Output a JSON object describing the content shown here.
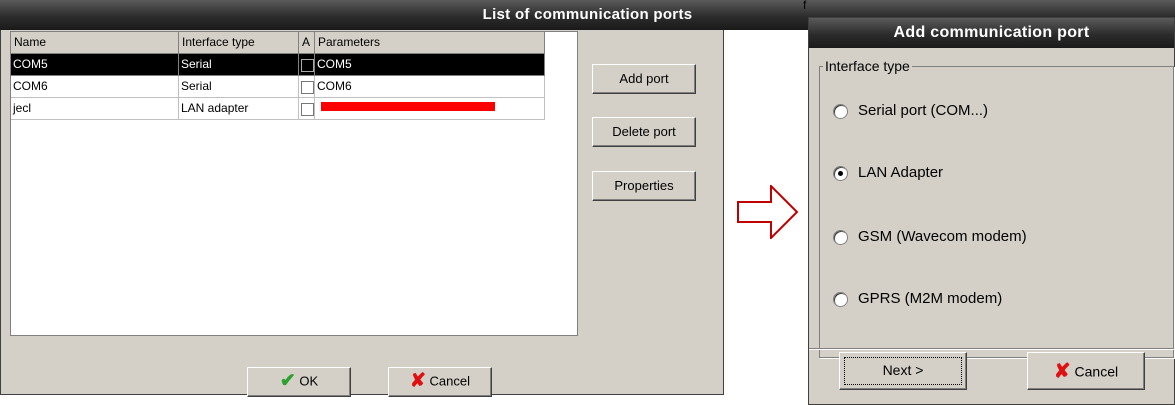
{
  "ports_window": {
    "title": "List of communication ports",
    "columns": [
      "Name",
      "Interface type",
      "A",
      "Parameters"
    ],
    "rows": [
      {
        "name": "COM5",
        "interface": "Serial",
        "active": false,
        "params": "COM5",
        "selected": true
      },
      {
        "name": "COM6",
        "interface": "Serial",
        "active": false,
        "params": "COM6",
        "selected": false
      },
      {
        "name": "jecl",
        "interface": "LAN adapter",
        "active": false,
        "params": "",
        "selected": false
      }
    ],
    "buttons": {
      "add_port": "Add port",
      "delete_port": "Delete port",
      "properties": "Properties",
      "ok": "OK",
      "cancel": "Cancel"
    },
    "redaction_color": "#ff0000"
  },
  "arrow": {
    "color": "#c00000"
  },
  "add_window": {
    "behind_text": "f",
    "title": "Add communication port",
    "group_label": "Interface type",
    "options": [
      {
        "label": "Serial port (COM...)",
        "selected": false
      },
      {
        "label": "LAN Adapter",
        "selected": true
      },
      {
        "label": "GSM (Wavecom modem)",
        "selected": false
      },
      {
        "label": "GPRS (M2M modem)",
        "selected": false
      }
    ],
    "buttons": {
      "next": "Next >",
      "cancel": "Cancel"
    }
  }
}
